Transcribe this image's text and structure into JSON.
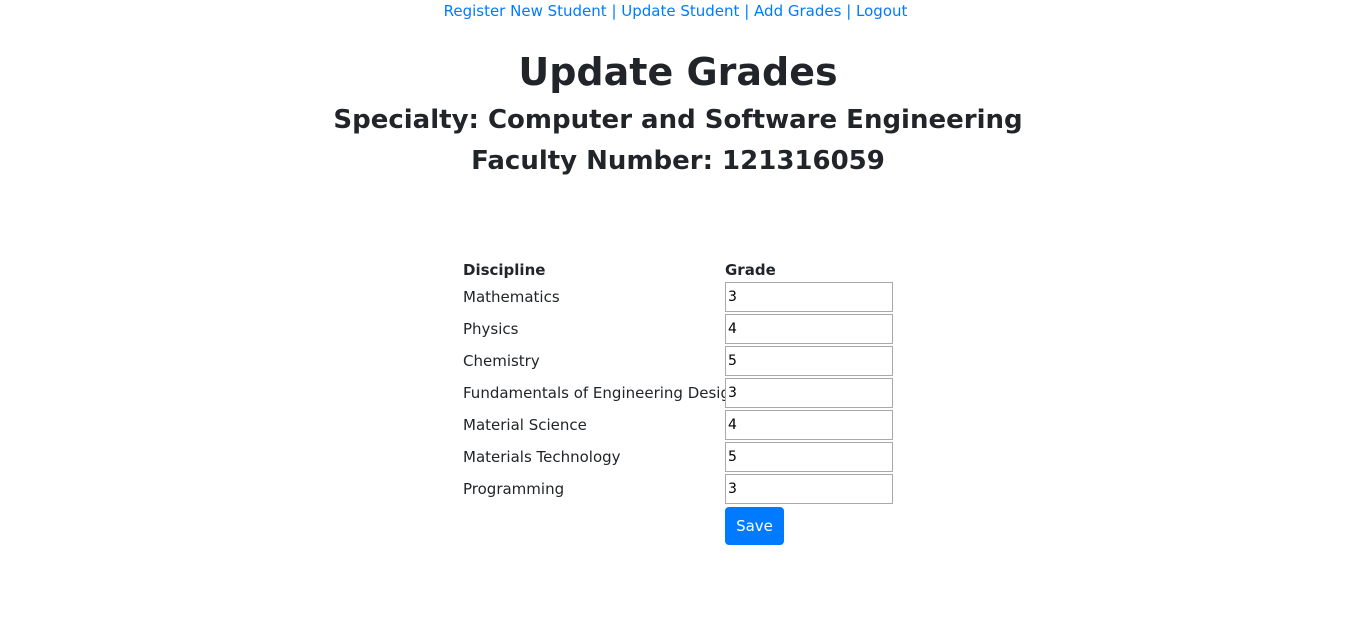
{
  "nav": {
    "links": [
      {
        "label": "Register New Student"
      },
      {
        "label": "Update Student"
      },
      {
        "label": "Add Grades"
      },
      {
        "label": "Logout"
      }
    ],
    "separator": "|"
  },
  "header": {
    "title": "Update Grades",
    "specialty": "Specialty: Computer and Software Engineering",
    "faculty_number": "Faculty Number: 121316059"
  },
  "grades_table": {
    "headers": {
      "discipline": "Discipline",
      "grade": "Grade"
    },
    "rows": [
      {
        "discipline": "Mathematics",
        "grade": "3"
      },
      {
        "discipline": "Physics",
        "grade": "4"
      },
      {
        "discipline": "Chemistry",
        "grade": "5"
      },
      {
        "discipline": "Fundamentals of Engineering Design",
        "grade": "3"
      },
      {
        "discipline": "Material Science",
        "grade": "4"
      },
      {
        "discipline": "Materials Technology",
        "grade": "5"
      },
      {
        "discipline": "Programming",
        "grade": "3"
      }
    ]
  },
  "actions": {
    "save_label": "Save"
  },
  "colors": {
    "link": "#007bff",
    "button": "#007bff",
    "text": "#212529"
  }
}
